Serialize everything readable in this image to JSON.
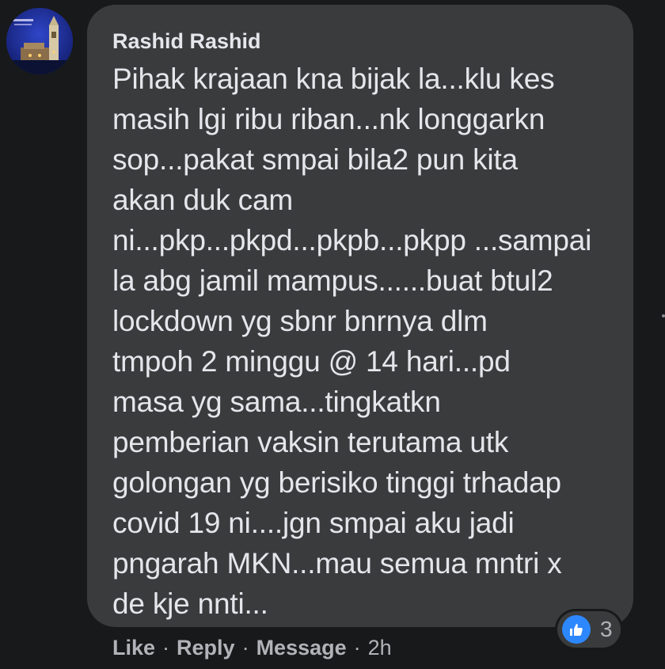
{
  "comment": {
    "author": "Rashid Rashid",
    "text": "Pihak krajaan kna bijak la...klu kes\nmasih lgi ribu riban...nk longgarkn\nsop...pakat smpai bila2 pun kita\nakan duk cam\nni...pkp...pkpd...pkpb...pkpp ...sampai\nla abg jamil mampus......buat btul2\nlockdown yg sbnr bnrnya dlm\ntmpoh 2 minggu @ 14 hari...pd\nmasa yg sama...tingkatkn\npemberian vaksin terutama utk\ngolongan yg berisiko tinggi trhadap\ncovid 19 ni....jgn smpai aku jadi\npngarah MKN...mau semua mntri x\nde kje nnti..."
  },
  "actions": {
    "like": "Like",
    "reply": "Reply",
    "message": "Message",
    "separator": "·",
    "timestamp": "2h"
  },
  "reactions": {
    "icon": "thumbs-up-icon",
    "count": "3"
  },
  "colors": {
    "background": "#18191a",
    "bubble": "#3a3b3c",
    "text": "#e4e6eb",
    "secondary_text": "#b0b3b8",
    "like_blue": "#2d88ff"
  }
}
